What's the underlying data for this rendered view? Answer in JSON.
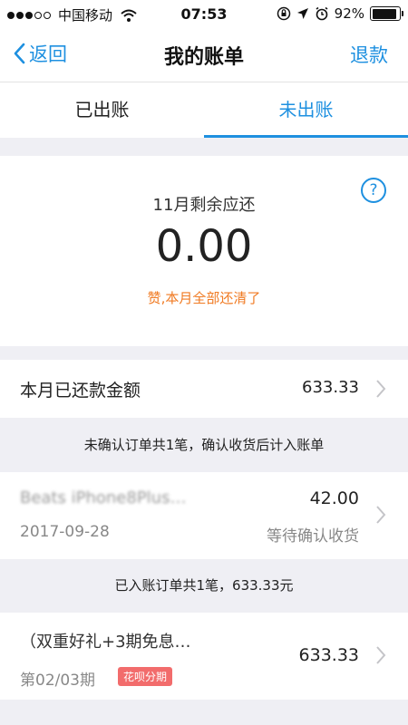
{
  "status_bar": {
    "carrier": "中国移动",
    "time": "07:53",
    "battery": "92%",
    "battery_level": 0.92
  },
  "nav": {
    "back_label": "返回",
    "title": "我的账单",
    "refund_label": "退款"
  },
  "tabs": [
    {
      "label": "已出账",
      "active": false
    },
    {
      "label": "未出账",
      "active": true
    }
  ],
  "summary": {
    "label": "11月剩余应还",
    "amount": "0.00",
    "note": "赞,本月全部还清了"
  },
  "repaid": {
    "label": "本月已还款金额",
    "value": "633.33"
  },
  "sections": {
    "unconfirmed": "未确认订单共1笔，确认收货后计入账单",
    "posted": "已入账订单共1笔，633.33元"
  },
  "orders": [
    {
      "name": "Beats iPhone8Plus…",
      "amount": "42.00",
      "date": "2017-09-28",
      "status": "等待确认收货"
    },
    {
      "name": "（双重好礼+3期免息…",
      "amount": "633.33",
      "date": "第02/03期",
      "badge": "花呗分期"
    }
  ],
  "colors": {
    "accent": "#1e90e0",
    "note": "#f07a22",
    "badge": "#f26c6c"
  }
}
